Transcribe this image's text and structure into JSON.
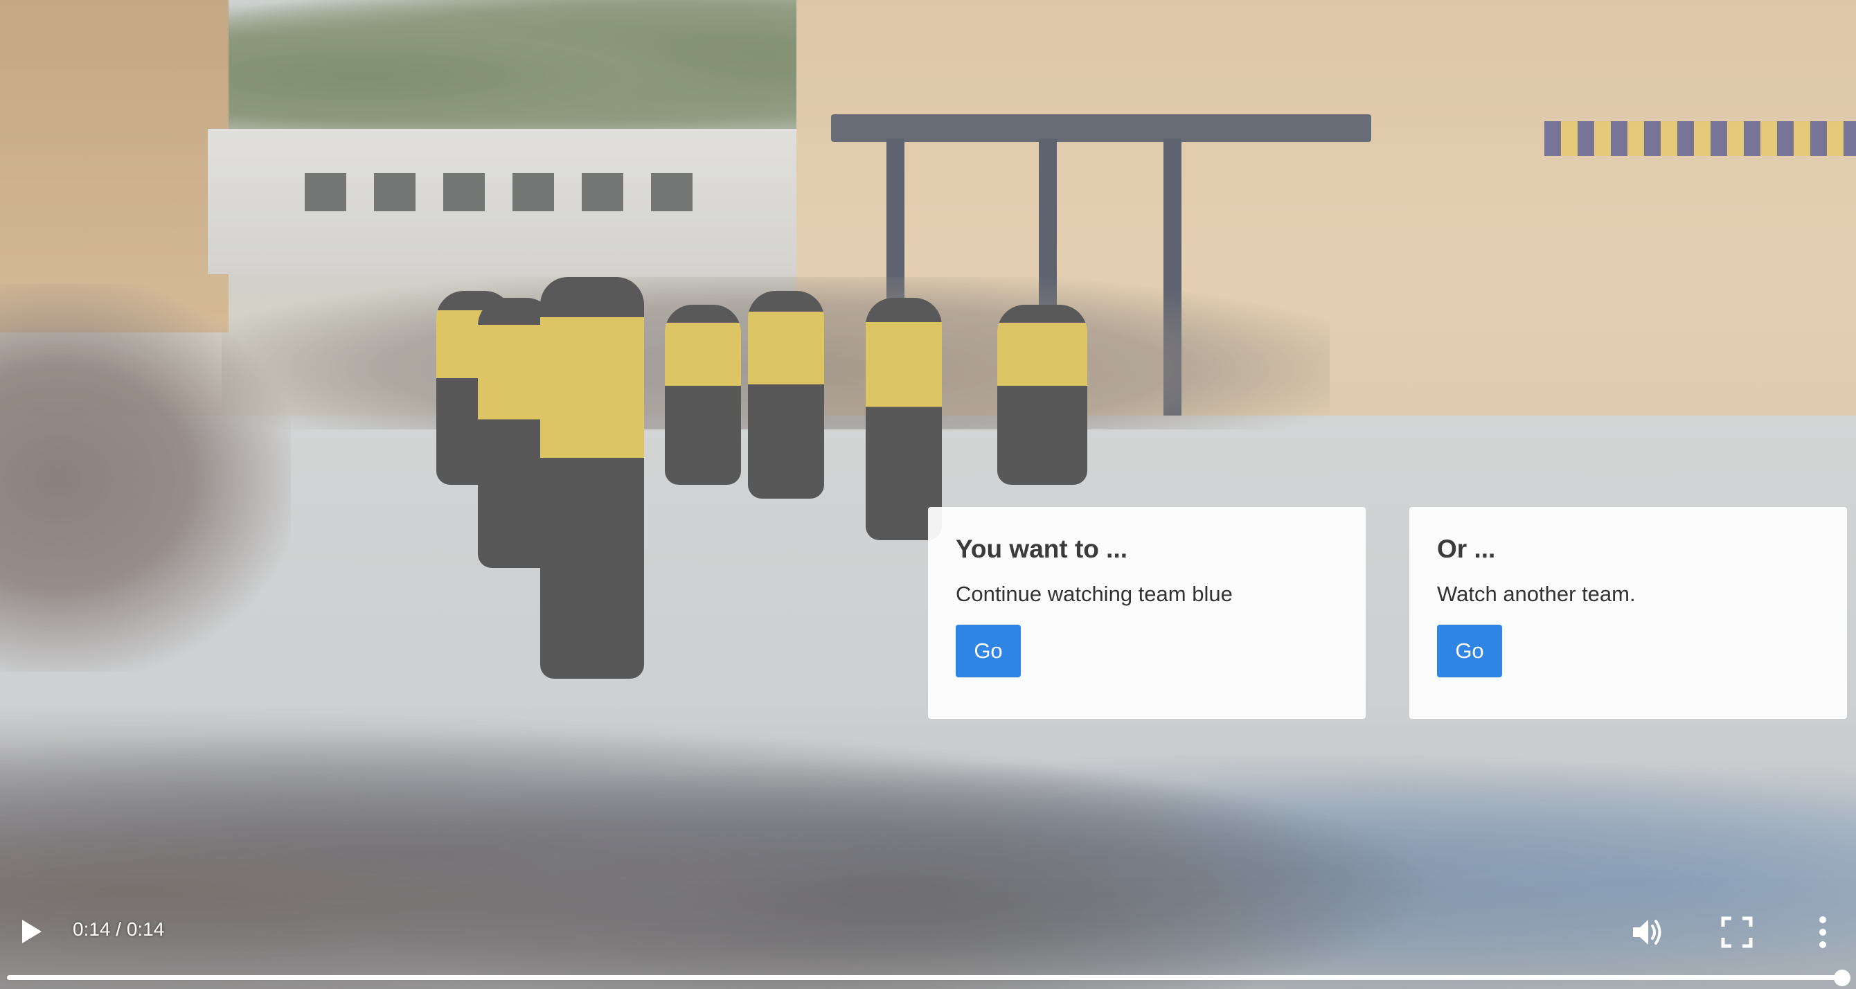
{
  "video": {
    "current_time": "0:14",
    "duration": "0:14",
    "time_display": "0:14 / 0:14",
    "progress": 1.0
  },
  "choices": [
    {
      "title": "You want to ...",
      "text": "Continue watching team blue",
      "button_label": "Go"
    },
    {
      "title": "Or ...",
      "text": "Watch another team.",
      "button_label": "Go"
    }
  ],
  "controls": {
    "icons": [
      "play-icon",
      "volume-icon",
      "fullscreen-icon",
      "more-options-icon"
    ]
  },
  "colors": {
    "button": "#2e85e6",
    "card_background": "#ffffff",
    "control_icons": "#ffffff"
  }
}
